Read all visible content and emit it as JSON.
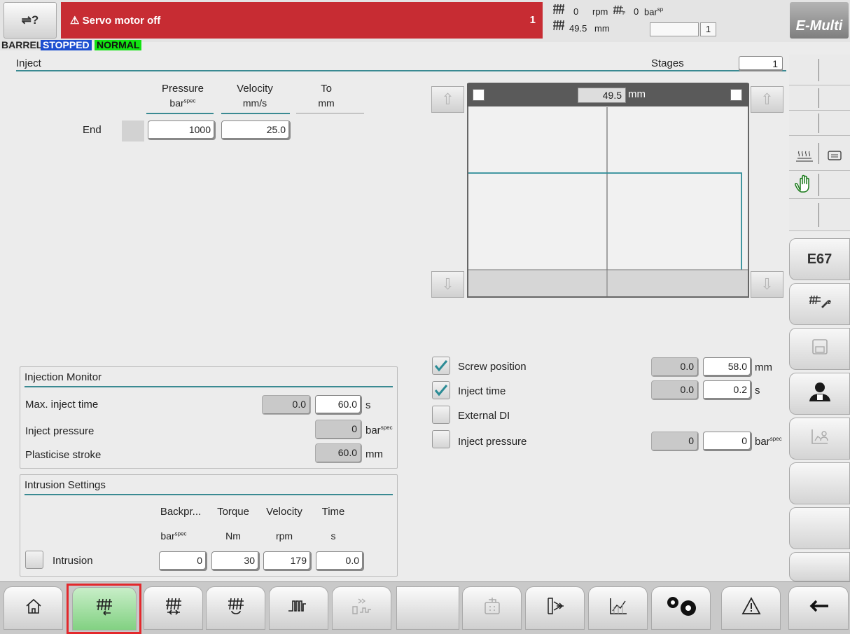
{
  "header": {
    "help_icon_text": "⇌?",
    "alarm_text": "⚠ Servo motor off",
    "alarm_count": "1",
    "screw_rpm_value": "0",
    "screw_rpm_unit": "rpm",
    "screw_pos_value": "49.5",
    "screw_pos_unit": "mm",
    "pressure_value": "0",
    "pressure_unit": "bar",
    "pressure_sup": "sp",
    "cycle_count": "1",
    "logo": "E-Multi"
  },
  "status": {
    "barrel": "BARREL",
    "state": "STOPPED",
    "mode": "NORMAL"
  },
  "inject": {
    "title": "Inject",
    "stages_label": "Stages",
    "stages_value": "1",
    "columns": [
      {
        "label": "Pressure",
        "unit": "bar",
        "sup": "spec"
      },
      {
        "label": "Velocity",
        "unit": "mm/s",
        "sup": ""
      },
      {
        "label": "To",
        "unit": "mm",
        "sup": ""
      }
    ],
    "end_label": "End",
    "end_pressure": "1000",
    "end_velocity": "25.0"
  },
  "graph": {
    "position_value": "49.5",
    "position_unit": "mm"
  },
  "switchover": {
    "screw_position": {
      "label": "Screw position",
      "checked": true,
      "actual": "0.0",
      "set": "58.0",
      "unit": "mm"
    },
    "inject_time": {
      "label": "Inject time",
      "checked": true,
      "actual": "0.0",
      "set": "0.2",
      "unit": "s"
    },
    "external_di": {
      "label": "External DI",
      "checked": false
    },
    "inject_pressure": {
      "label": "Inject pressure",
      "checked": false,
      "actual": "0",
      "set": "0",
      "unit": "bar",
      "sup": "spec"
    }
  },
  "monitor": {
    "title": "Injection Monitor",
    "max_inject_time": {
      "label": "Max. inject time",
      "actual": "0.0",
      "set": "60.0",
      "unit": "s"
    },
    "inject_pressure": {
      "label": "Inject pressure",
      "value": "0",
      "unit": "bar",
      "sup": "spec"
    },
    "plasticise_stroke": {
      "label": "Plasticise stroke",
      "value": "60.0",
      "unit": "mm"
    }
  },
  "intrusion": {
    "title": "Intrusion Settings",
    "columns": [
      {
        "label": "Backpr...",
        "unit": "bar",
        "sup": "spec"
      },
      {
        "label": "Torque",
        "unit": "Nm",
        "sup": ""
      },
      {
        "label": "Velocity",
        "unit": "rpm",
        "sup": ""
      },
      {
        "label": "Time",
        "unit": "s",
        "sup": ""
      }
    ],
    "row_label": "Intrusion",
    "backpressure": "0",
    "torque": "30",
    "velocity": "179",
    "time": "0.0"
  },
  "sidebar": {
    "e67_label": "E67"
  },
  "colors": {
    "alarm_red": "#c72c33",
    "accent_teal": "#3a8a92",
    "stopped_blue": "#1d4fd0",
    "normal_green": "#12e212",
    "active_nav_green": "#82d182",
    "active_outline_red": "#e3282c"
  },
  "icons": [
    "home-icon",
    "inject-icon",
    "hold-pressure-icon",
    "plasticise-icon",
    "heating-icon",
    "sequence-icon",
    "mould-icon",
    "ejector-icon",
    "graph-icon",
    "settings-icon",
    "alarm-icon",
    "back-arrow-icon",
    "manual-hand-icon",
    "wrench-icon",
    "user-icon"
  ]
}
